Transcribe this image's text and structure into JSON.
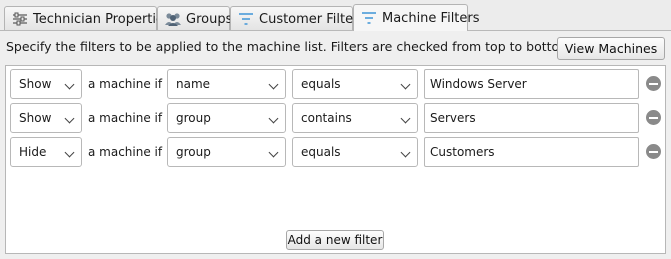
{
  "tabs": [
    {
      "label": "Technician Properties",
      "icon": "sliders-icon"
    },
    {
      "label": "Groups",
      "icon": "groups-icon"
    },
    {
      "label": "Customer Filters",
      "icon": "filter-icon"
    },
    {
      "label": "Machine Filters",
      "icon": "filter-icon",
      "active": true
    }
  ],
  "description": "Specify the filters to be applied to the machine list. Filters are checked from top to bottom.",
  "view_machines_label": "View Machines",
  "add_filter_label": "Add a new filter",
  "filters": [
    {
      "action": "Show",
      "connector": "a machine if its",
      "field": "name",
      "operator": "equals",
      "value": "Windows Server"
    },
    {
      "action": "Show",
      "connector": "a machine if its",
      "field": "group",
      "operator": "contains",
      "value": "Servers"
    },
    {
      "action": "Hide",
      "connector": "a machine if its",
      "field": "group",
      "operator": "equals",
      "value": "Customers"
    }
  ],
  "colors": {
    "filter_icon": "#4a9bd9",
    "remove_button": "#8a8a8a"
  }
}
